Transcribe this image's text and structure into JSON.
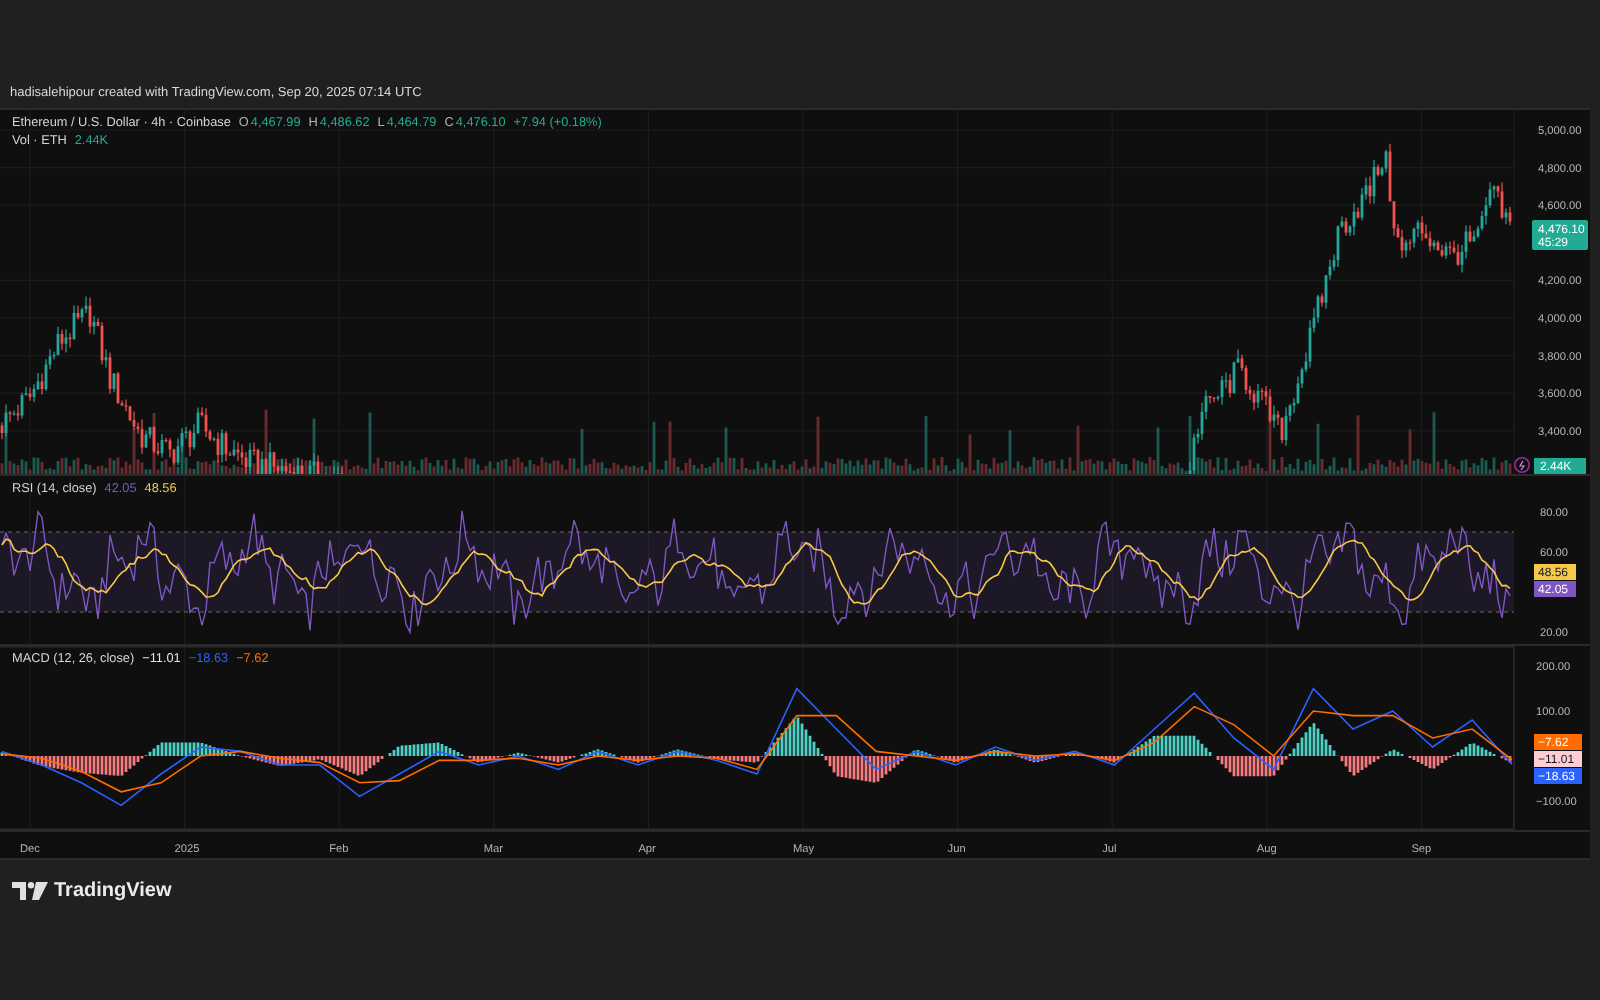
{
  "header": {
    "text": "hadisalehipour created with TradingView.com, Sep 20, 2025 07:14 UTC"
  },
  "price_pane": {
    "title": "Ethereum / U.S. Dollar · 4h · Coinbase",
    "ohlc": [
      {
        "label": "O",
        "value": "4,467.99"
      },
      {
        "label": "H",
        "value": "4,486.62"
      },
      {
        "label": "L",
        "value": "4,464.79"
      },
      {
        "label": "C",
        "value": "4,476.10"
      }
    ],
    "change": "+7.94 (+0.18%)",
    "axis_labels": [
      "5,000.00",
      "4,800.00",
      "4,600.00",
      "4,200.00",
      "4,000.00",
      "3,800.00",
      "3,600.00",
      "3,400.00"
    ],
    "price_badge": {
      "price": "4,476.10",
      "countdown": "45:29"
    }
  },
  "volume": {
    "label": "Vol · ETH",
    "value": "2.44K",
    "badge": "2.44K"
  },
  "rsi_pane": {
    "label": "RSI (14, close)",
    "values": [
      {
        "text": "42.05",
        "color": "#7e57c2"
      },
      {
        "text": "48.56",
        "color": "#f7c948"
      }
    ],
    "axis_labels": [
      "80.00",
      "60.00",
      "20.00"
    ],
    "badges": [
      {
        "text": "48.56",
        "color": "#f7c948"
      },
      {
        "text": "42.05",
        "color": "#7e57c2"
      }
    ]
  },
  "macd_pane": {
    "label": "MACD (12, 26, close)",
    "values": [
      {
        "text": "−11.01",
        "color": "#f3e0e0"
      },
      {
        "text": "−18.63",
        "color": "#2962ff"
      },
      {
        "text": "−7.62",
        "color": "#ff6d00"
      }
    ],
    "chart_data": {
      "type": "line",
      "ylim": [
        -165,
        245
      ],
      "yticks": [
        {
          "value": 200,
          "label": "200.00"
        },
        {
          "value": 100,
          "label": "100.00"
        },
        {
          "value": -100,
          "label": "−100.00"
        }
      ],
      "series": [
        {
          "color": "#2962ff",
          "values": [
            10,
            -20,
            -60,
            -110,
            -40,
            20,
            10,
            -20,
            -20,
            -90,
            -40,
            10,
            -20,
            0,
            -30,
            10,
            -20,
            10,
            -10,
            -40,
            150,
            60,
            -30,
            10,
            -20,
            20,
            -10,
            10,
            -20,
            60,
            140,
            40,
            -30,
            150,
            60,
            100,
            20,
            80,
            -19
          ]
        },
        {
          "color": "#ff6d00",
          "values": [
            5,
            -5,
            -35,
            -80,
            -60,
            0,
            10,
            -5,
            -15,
            -60,
            -55,
            -10,
            -10,
            -5,
            -20,
            0,
            -10,
            0,
            -5,
            -30,
            90,
            90,
            10,
            0,
            -10,
            10,
            0,
            5,
            -10,
            30,
            110,
            70,
            0,
            100,
            90,
            90,
            40,
            60,
            -8
          ]
        }
      ]
    },
    "badges": [
      {
        "text": "−7.62",
        "color": "#ff6d00"
      },
      {
        "text": "−11.01",
        "color": "#ffcdd2"
      },
      {
        "text": "−18.63",
        "color": "#2962ff"
      }
    ]
  },
  "time_axis": [
    "Dec",
    "2025",
    "Feb",
    "Mar",
    "Apr",
    "May",
    "Jun",
    "Jul",
    "Aug",
    "Sep"
  ],
  "footer": {
    "logo_text": "TradingView"
  }
}
